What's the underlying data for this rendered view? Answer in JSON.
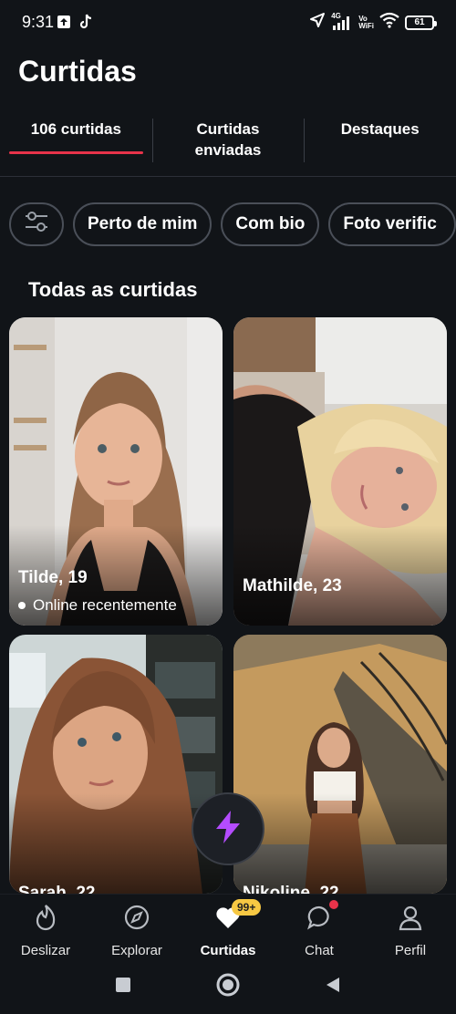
{
  "status_bar": {
    "time": "9:31",
    "net_top": "4G",
    "vowifi_top": "Vo",
    "vowifi_bottom": "WiFi",
    "battery": "61"
  },
  "page": {
    "title": "Curtidas"
  },
  "tabs": [
    {
      "label": "106 curtidas",
      "active": true
    },
    {
      "label": "Curtidas enviadas",
      "active": false
    },
    {
      "label": "Destaques",
      "active": false
    }
  ],
  "filters": {
    "icon": "sliders-icon",
    "chips": [
      "Perto de mim",
      "Com bio",
      "Foto verific"
    ]
  },
  "section": {
    "title": "Todas as curtidas"
  },
  "cards": [
    {
      "name": "Tilde, 19",
      "status": "Online recentemente"
    },
    {
      "name": "Mathilde, 23",
      "status": ""
    },
    {
      "name": "Sarah, 22",
      "status": ""
    },
    {
      "name": "Nikoline, 22",
      "status": ""
    }
  ],
  "bottom_nav": [
    {
      "label": "Deslizar",
      "icon": "flame-icon"
    },
    {
      "label": "Explorar",
      "icon": "compass-icon"
    },
    {
      "label": "Curtidas",
      "icon": "heart-icon",
      "active": true,
      "badge": "99+"
    },
    {
      "label": "Chat",
      "icon": "chat-bubble-icon"
    },
    {
      "label": "Perfil",
      "icon": "person-icon"
    }
  ],
  "colors": {
    "background": "#111418",
    "accent": "#e8334a",
    "badge": "#f7c843",
    "boost": "#b44cff"
  }
}
